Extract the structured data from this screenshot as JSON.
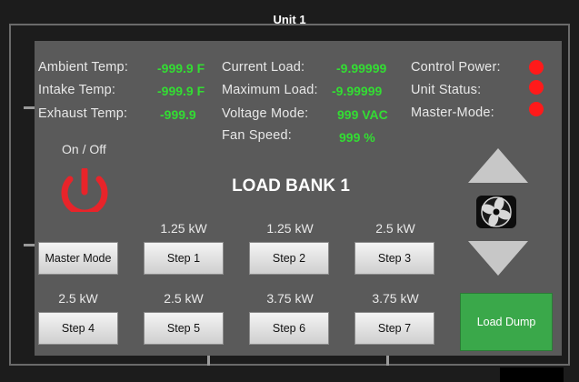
{
  "window": {
    "title": "Unit 1"
  },
  "readouts": {
    "ambient": {
      "label": "Ambient Temp:",
      "value": "-999.9 F"
    },
    "intake": {
      "label": "Intake Temp:",
      "value": "-999.9 F"
    },
    "exhaust": {
      "label": "Exhaust Temp:",
      "value": "-999.9"
    },
    "current_load": {
      "label": "Current Load:",
      "value": "-9.99999"
    },
    "max_load": {
      "label": "Maximum Load:",
      "value": "-9.99999"
    },
    "voltage_mode": {
      "label": "Voltage Mode:",
      "value": "999 VAC"
    },
    "fan_speed": {
      "label": "Fan Speed:",
      "value": "999 %"
    }
  },
  "status": {
    "control_power": {
      "label": "Control Power:",
      "color": "#ff1a1a"
    },
    "unit_status": {
      "label": "Unit Status:",
      "color": "#ff1a1a"
    },
    "master_mode": {
      "label": "Master-Mode:",
      "color": "#ff1a1a"
    }
  },
  "power": {
    "label": "On / Off",
    "icon": "power-icon",
    "color": "#e8242a"
  },
  "bank_title": "LOAD BANK 1",
  "steps_row1": [
    {
      "kw": "",
      "label": "Master Mode"
    },
    {
      "kw": "1.25 kW",
      "label": "Step 1"
    },
    {
      "kw": "1.25 kW",
      "label": "Step 2"
    },
    {
      "kw": "2.5 kW",
      "label": "Step 3"
    }
  ],
  "steps_row2": [
    {
      "kw": "2.5 kW",
      "label": "Step 4"
    },
    {
      "kw": "2.5 kW",
      "label": "Step 5"
    },
    {
      "kw": "3.75 kW",
      "label": "Step 6"
    },
    {
      "kw": "3.75 kW",
      "label": "Step 7"
    }
  ],
  "load_dump": {
    "label": "Load Dump",
    "color": "#3aa84a"
  },
  "fan_controls": {
    "up_icon": "arrow-up-icon",
    "down_icon": "arrow-down-icon",
    "fan_icon": "fan-icon"
  }
}
